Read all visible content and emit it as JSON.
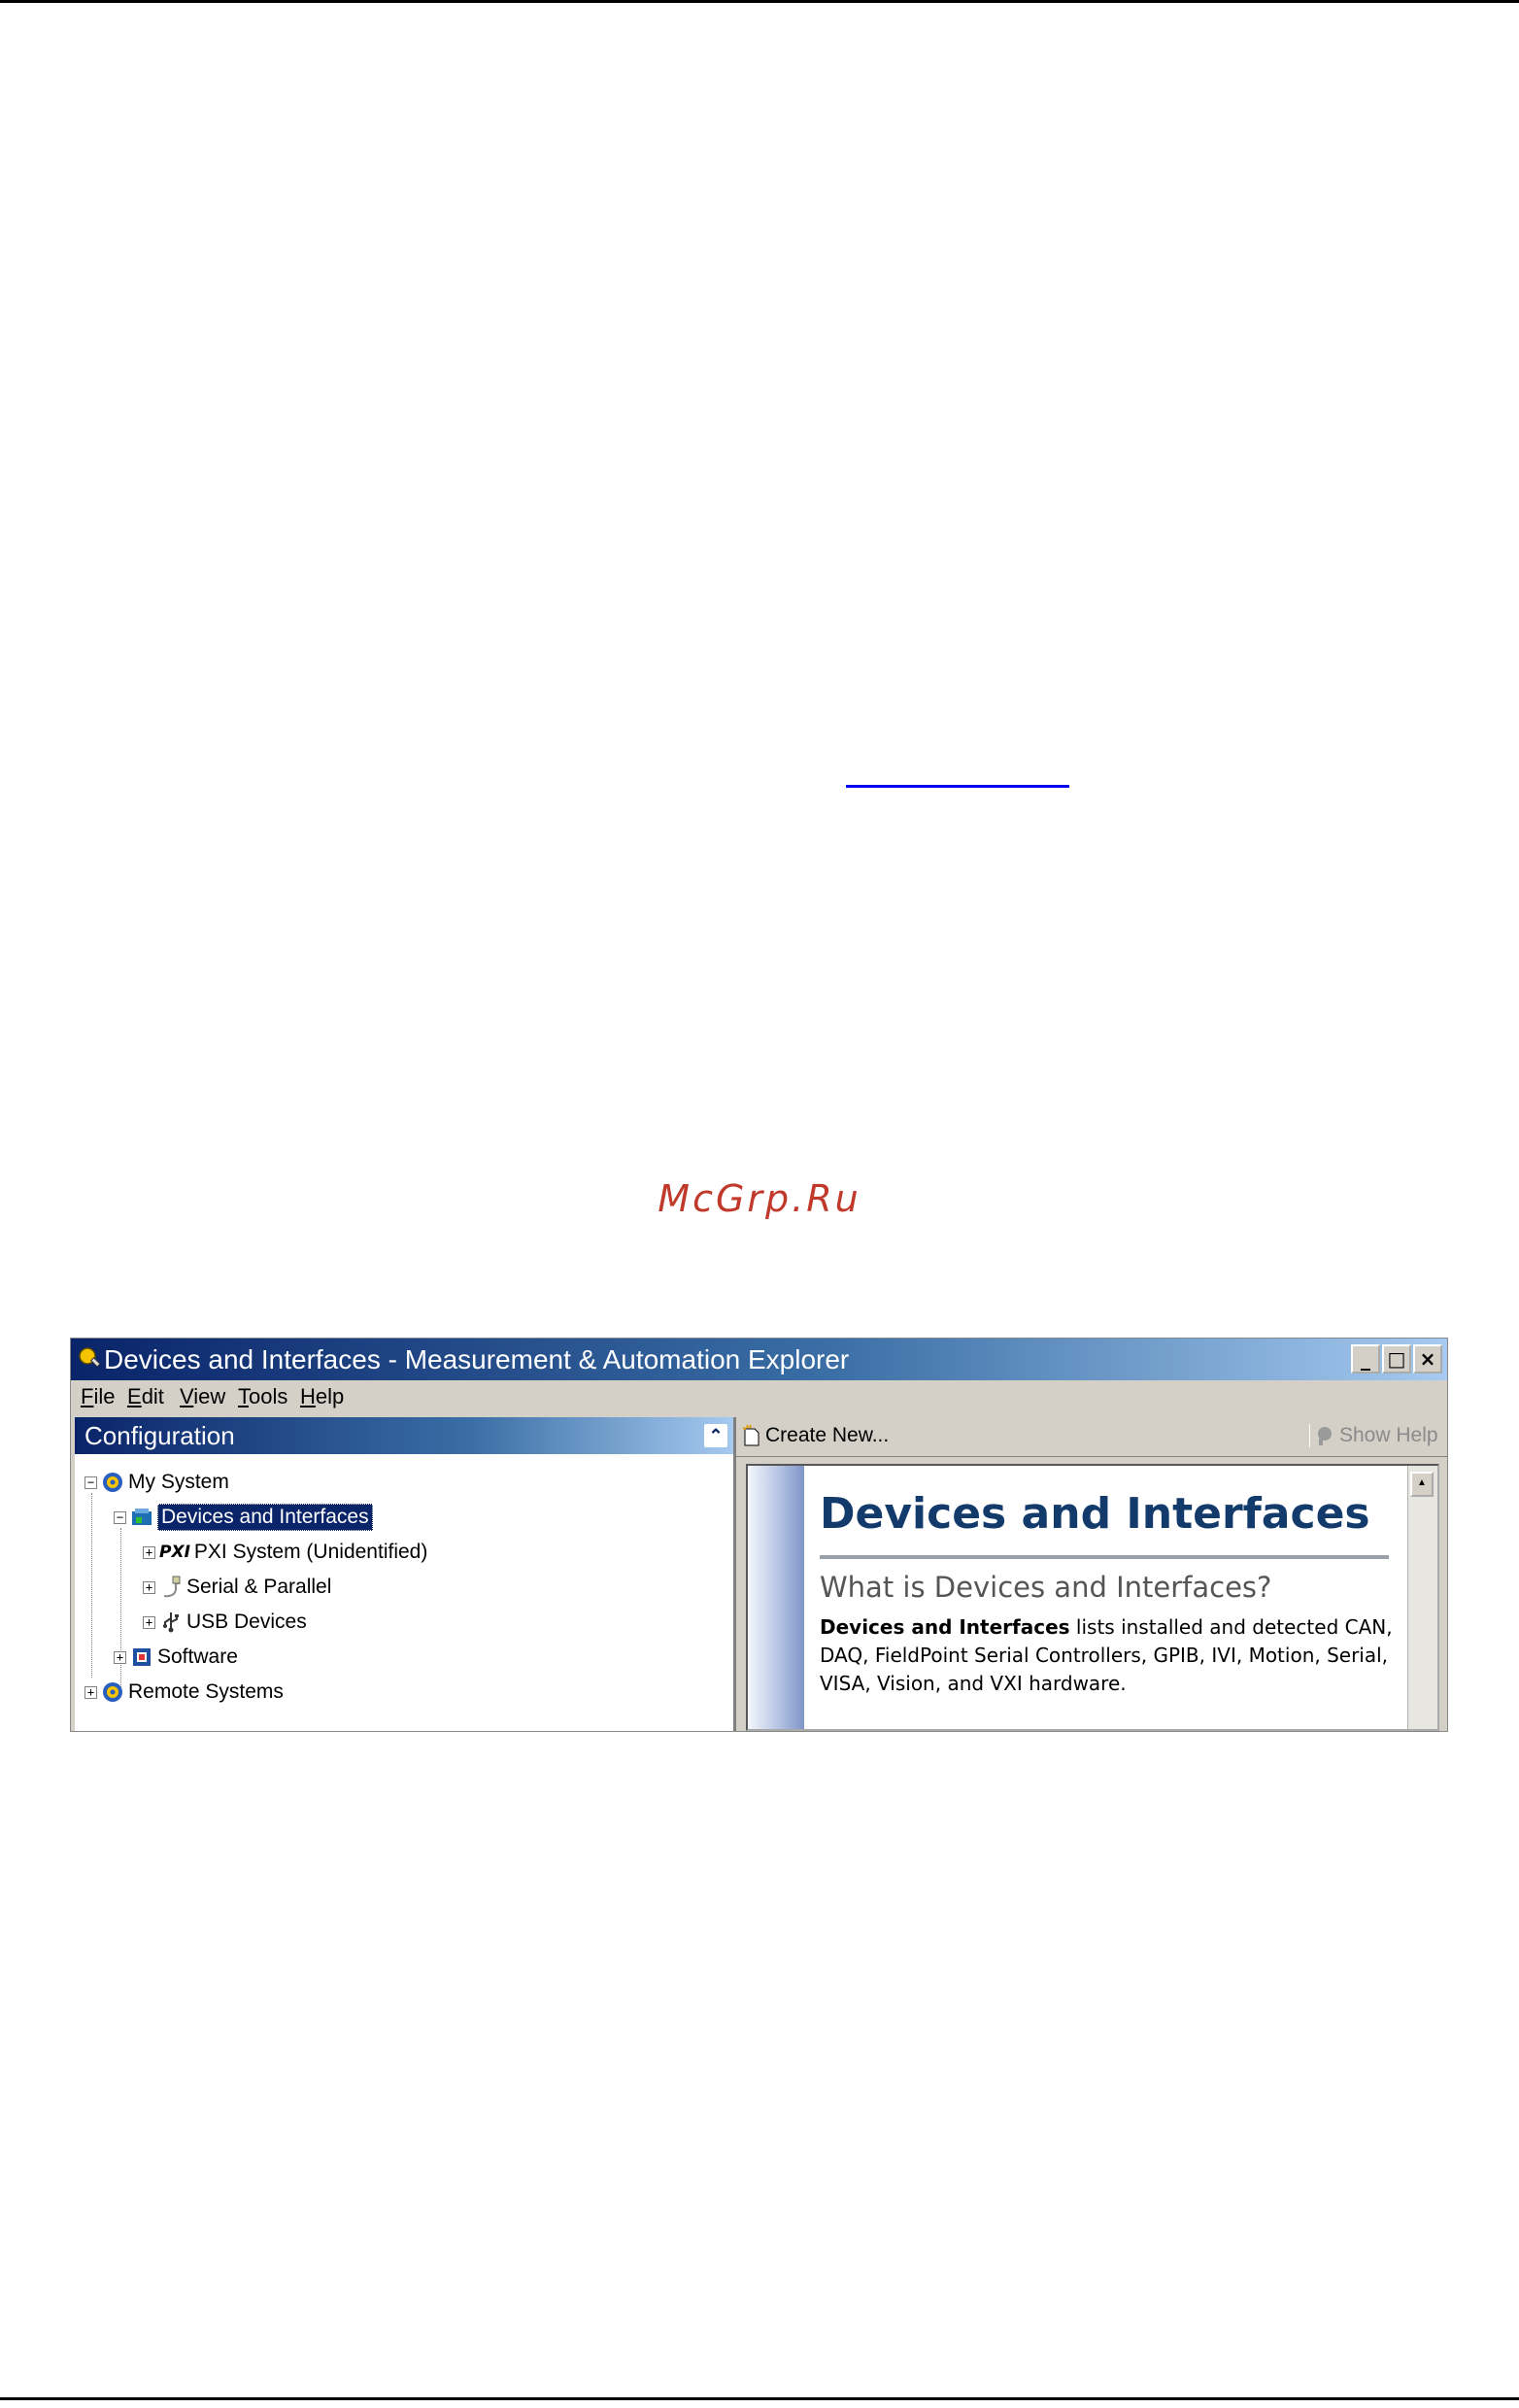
{
  "watermark": "McGrp.Ru",
  "window": {
    "title": "Devices and Interfaces - Measurement & Automation Explorer",
    "controls": {
      "minimize": "_",
      "maximize": "□",
      "close": "×"
    }
  },
  "menu": [
    {
      "underline": "F",
      "rest": "ile"
    },
    {
      "underline": "E",
      "rest": "dit"
    },
    {
      "underline": "V",
      "rest": "iew"
    },
    {
      "underline": "T",
      "rest": "ools"
    },
    {
      "underline": "H",
      "rest": "elp"
    }
  ],
  "left_pane": {
    "header": "Configuration",
    "tree": [
      {
        "label": "My System",
        "expander": "−"
      },
      {
        "label": "Devices and Interfaces",
        "expander": "−"
      },
      {
        "label": "PXI System (Unidentified)",
        "expander": "+",
        "badge": "PXI"
      },
      {
        "label": "Serial & Parallel",
        "expander": "+"
      },
      {
        "label": "USB Devices",
        "expander": "+"
      },
      {
        "label": "Software",
        "expander": "+"
      },
      {
        "label": "Remote Systems",
        "expander": "+"
      }
    ]
  },
  "right_pane": {
    "create_new": "Create New...",
    "show_help": "Show Help",
    "help": {
      "title": "Devices and Interfaces",
      "subtitle": "What is Devices and Interfaces?",
      "body_bold": "Devices and Interfaces",
      "body_rest": " lists installed and detected CAN, DAQ, FieldPoint Serial Controllers, GPIB, IVI, Motion, Serial, VISA, Vision, and VXI hardware."
    }
  },
  "colors": {
    "titlebar_start": "#0a246a",
    "window_face": "#d4d0c8",
    "help_title": "#123a6b",
    "watermark": "#c0392b"
  }
}
